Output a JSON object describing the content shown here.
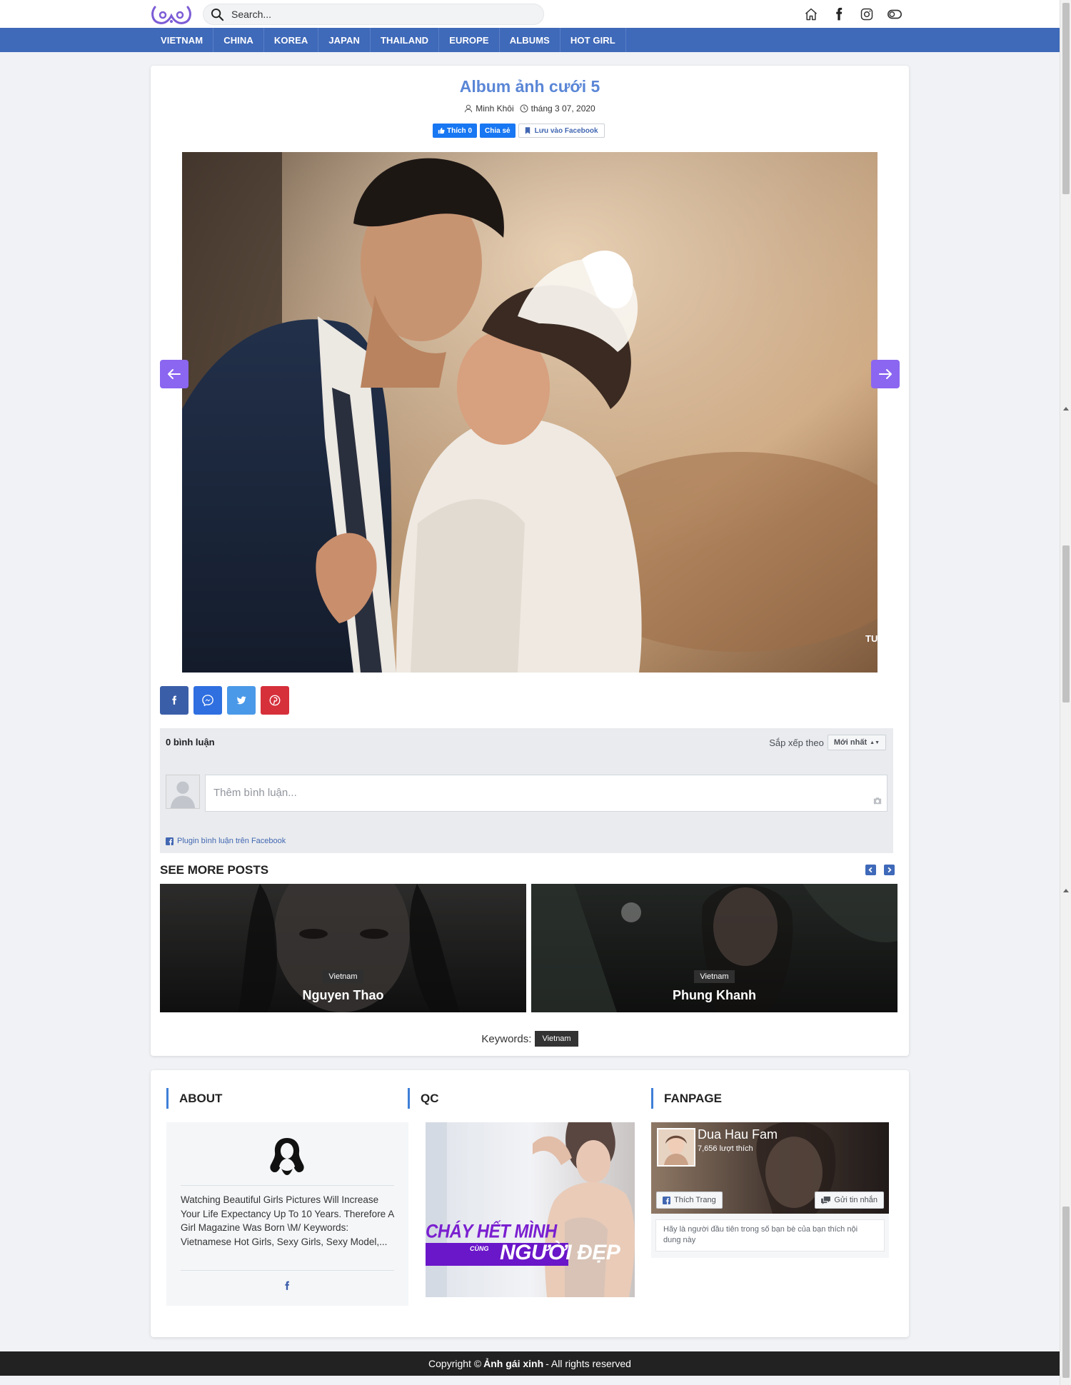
{
  "header": {
    "search_placeholder": "Search...",
    "icons": [
      "home-icon",
      "facebook-icon",
      "instagram-icon",
      "theme-toggle-icon"
    ]
  },
  "nav": {
    "items": [
      {
        "label": "VIETNAM"
      },
      {
        "label": "CHINA"
      },
      {
        "label": "KOREA"
      },
      {
        "label": "JAPAN"
      },
      {
        "label": "THAILAND"
      },
      {
        "label": "EUROPE"
      },
      {
        "label": "ALBUMS"
      },
      {
        "label": "HOT GIRL"
      }
    ]
  },
  "post": {
    "title": "Album ảnh cưới 5",
    "author": "Minh Khôi",
    "date": "tháng 3 07, 2020",
    "fb_like": "Thích 0",
    "fb_share": "Chia sẻ",
    "fb_save": "Lưu vào Facebook",
    "watermark": "TU"
  },
  "share": [
    "facebook-share-icon",
    "messenger-share-icon",
    "twitter-share-icon",
    "pinterest-share-icon"
  ],
  "comments": {
    "count_label": "0 bình luận",
    "sort_label": "Sắp xếp theo",
    "sort_value": "Mới nhất",
    "input_placeholder": "Thêm bình luận...",
    "plugin_label": "Plugin bình luận trên Facebook"
  },
  "see_more": {
    "title": "SEE MORE POSTS",
    "items": [
      {
        "category": "Vietnam",
        "name": "Nguyen Thao"
      },
      {
        "category": "Vietnam",
        "name": "Phung Khanh"
      }
    ]
  },
  "keywords": {
    "label": "Keywords:",
    "tags": [
      "Vietnam"
    ]
  },
  "widgets": {
    "about": {
      "title": "ABOUT",
      "text": "Watching Beautiful Girls Pictures Will Increase Your Life Expectancy Up To 10 Years. Therefore A Girl Magazine Was Born \\M/ Keywords: Vietnamese Hot Girls, Sexy Girls, Sexy Model,..."
    },
    "qc": {
      "title": "QC",
      "line1": "CHÁY HẾT MÌNH",
      "line2_small": "CÙNG",
      "line2": "NGƯỜI ĐẸP"
    },
    "fanpage": {
      "title": "FANPAGE",
      "name": "Dua Hau Fam",
      "likes": "7,656 lượt thích",
      "like_button": "Thích Trang",
      "message_button": "Gửi tin nhắn",
      "description": "Hãy là người đầu tiên trong số bạn bè của bạn thích nội dung này"
    }
  },
  "footer": {
    "prefix": "Copyright ©",
    "brand": "Ảnh gái xinh",
    "suffix": "- All rights reserved"
  },
  "colors": {
    "nav_blue": "#3f69b9",
    "title_blue": "#5a86d6",
    "slider_purple": "#8b66f0",
    "facebook_blue": "#1877f2"
  }
}
